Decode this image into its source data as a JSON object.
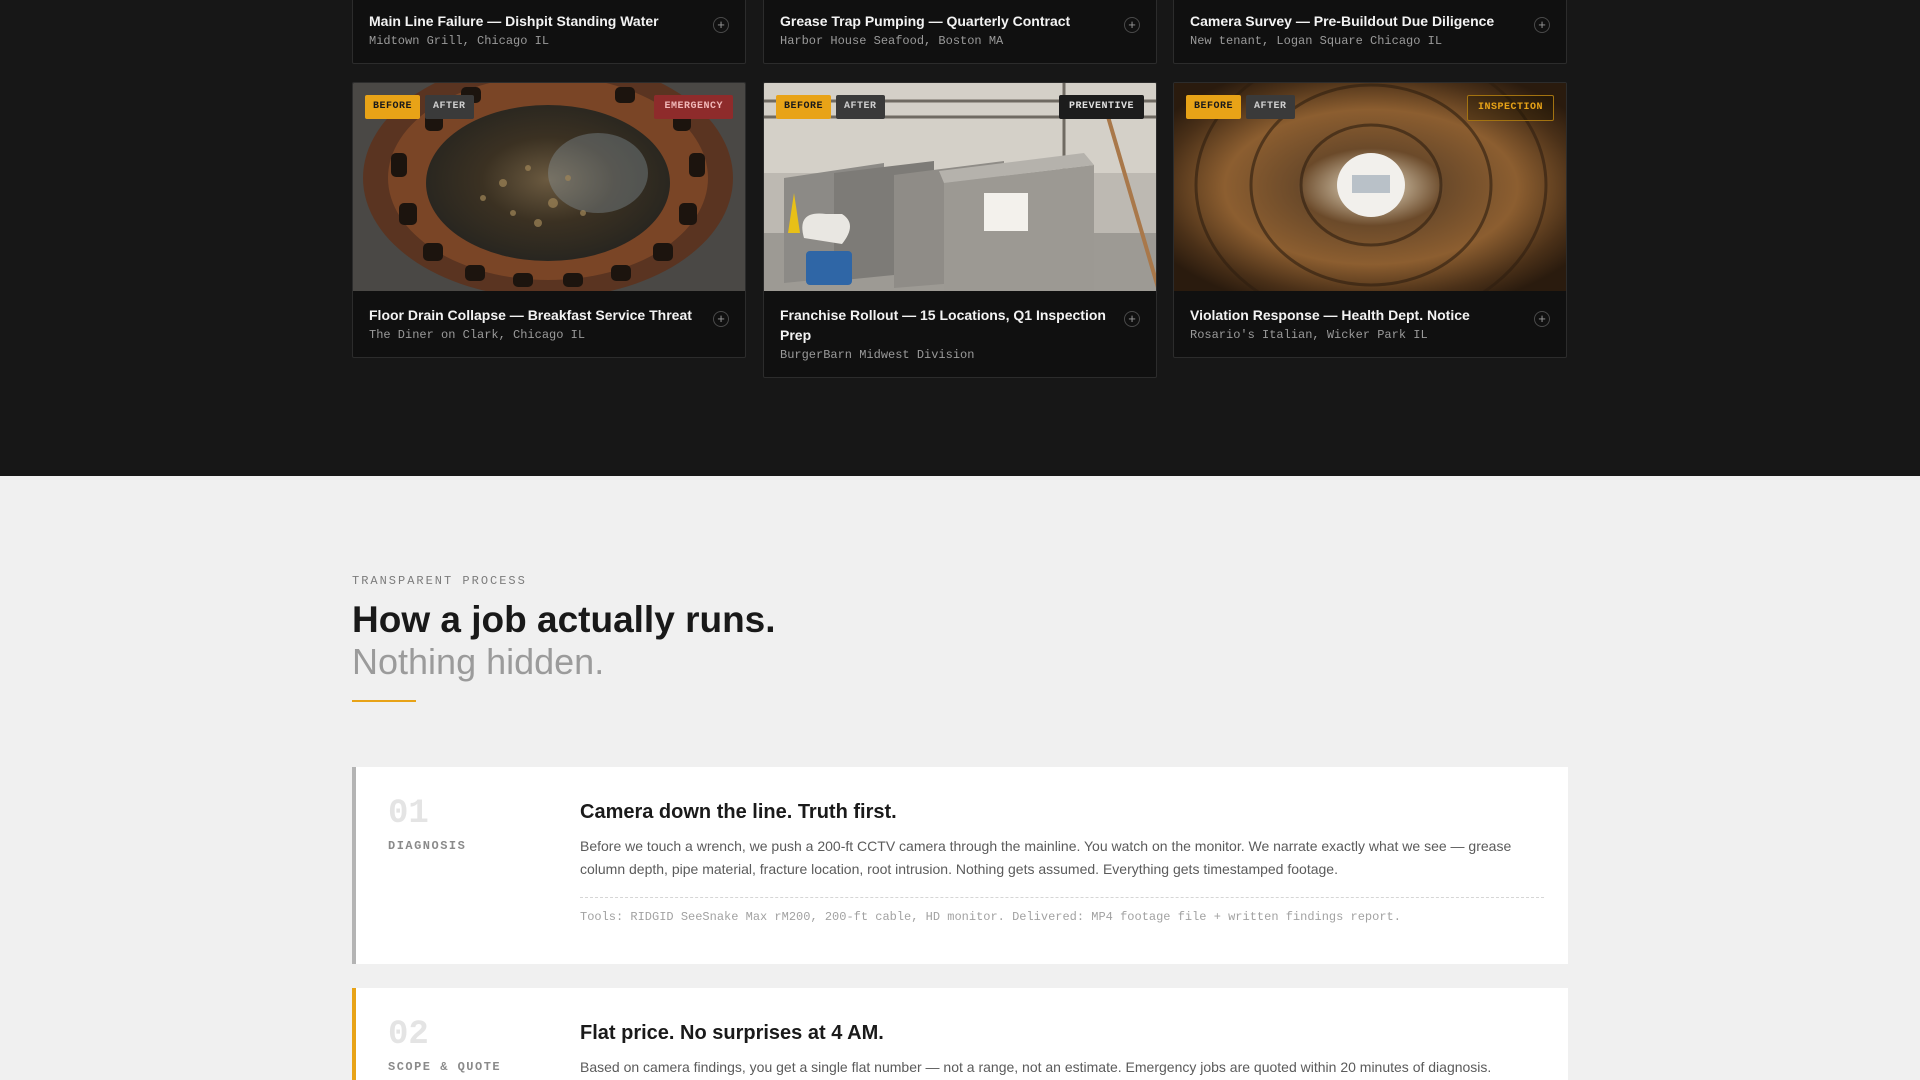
{
  "cards_top": [
    {
      "title": "Main Line Failure — Dishpit Standing Water",
      "subtitle": "Midtown Grill, Chicago IL"
    },
    {
      "title": "Grease Trap Pumping — Quarterly Contract",
      "subtitle": "Harbor House Seafood, Boston MA"
    },
    {
      "title": "Camera Survey — Pre-Buildout Due Diligence",
      "subtitle": "New tenant, Logan Square Chicago IL"
    }
  ],
  "cards_bottom": [
    {
      "title": "Floor Drain Collapse — Breakfast Service Threat",
      "subtitle": "The Diner on Clark, Chicago IL",
      "before": "BEFORE",
      "after": "AFTER",
      "tag": "EMERGENCY"
    },
    {
      "title": "Franchise Rollout — 15 Locations, Q1 Inspection Prep",
      "subtitle": "BurgerBarn Midwest Division",
      "before": "BEFORE",
      "after": "AFTER",
      "tag": "PREVENTIVE"
    },
    {
      "title": "Violation Response — Health Dept. Notice",
      "subtitle": "Rosario's Italian, Wicker Park IL",
      "before": "BEFORE",
      "after": "AFTER",
      "tag": "INSPECTION"
    }
  ],
  "expand_symbol": "+",
  "process": {
    "eyebrow": "TRANSPARENT PROCESS",
    "heading": "How a job actually runs.",
    "subheading": "Nothing hidden.",
    "steps": [
      {
        "num": "01",
        "label": "DIAGNOSIS",
        "title": "Camera down the line. Truth first.",
        "text": "Before we touch a wrench, we push a 200-ft CCTV camera through the mainline. You watch on the monitor. We narrate exactly what we see — grease column depth, pipe material, fracture location, root intrusion. Nothing gets assumed. Everything gets timestamped footage.",
        "tools": "Tools: RIDGID SeeSnake Max rM200, 200-ft cable, HD monitor. Delivered: MP4 footage file + written findings report."
      },
      {
        "num": "02",
        "label": "SCOPE & QUOTE",
        "title": "Flat price. No surprises at 4 AM.",
        "text": "Based on camera findings, you get a single flat number — not a range, not an estimate. Emergency jobs are quoted within 20 minutes of diagnosis."
      }
    ]
  },
  "colors": {
    "accent": "#e8a317",
    "dark_bg": "#171717",
    "light_bg": "#f0f0f0",
    "emergency": "#8e2b2b"
  },
  "icons": [
    "plus-circle-icon"
  ]
}
